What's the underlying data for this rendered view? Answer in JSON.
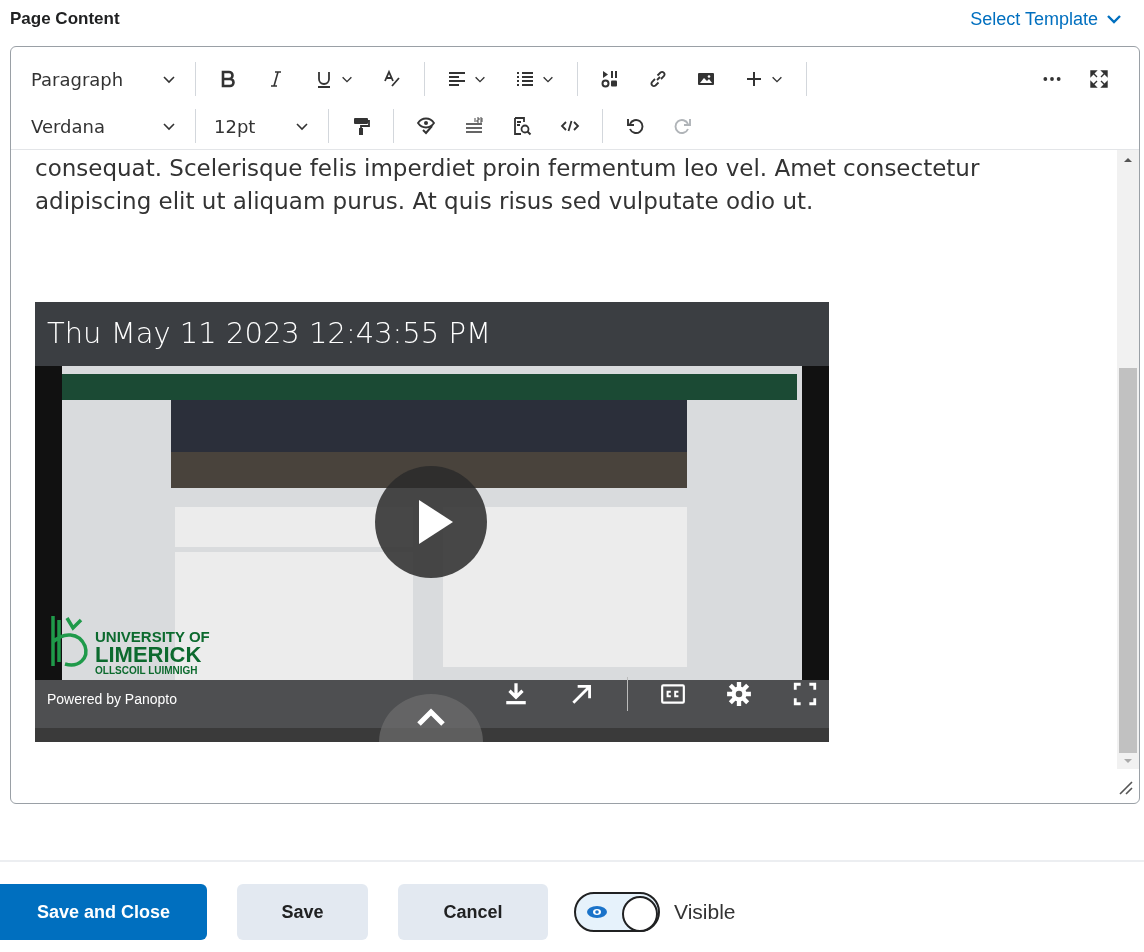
{
  "header": {
    "title": "Page Content",
    "template_link": "Select Template"
  },
  "toolbar": {
    "rows": [
      [
        [
          {
            "kind": "select",
            "label": "Paragraph"
          }
        ],
        [
          {
            "kind": "tool"
          },
          {
            "kind": "tool"
          },
          {
            "kind": "tool",
            "menu": true
          },
          {
            "kind": "tool"
          }
        ],
        [
          {
            "kind": "tool",
            "menu": true
          },
          {
            "kind": "tool",
            "menu": true
          }
        ],
        [
          {
            "kind": "tool"
          },
          {
            "kind": "tool"
          },
          {
            "kind": "tool"
          },
          {
            "kind": "tool",
            "menu": true
          }
        ],
        [
          {
            "kind": "tool"
          },
          {
            "kind": "tool"
          }
        ]
      ],
      [
        [
          {
            "kind": "select",
            "label": "Verdana"
          }
        ],
        [
          {
            "kind": "select",
            "label": "12pt"
          }
        ],
        [
          {
            "kind": "tool"
          }
        ],
        [
          {
            "kind": "tool"
          },
          {
            "kind": "tool"
          },
          {
            "kind": "tool"
          },
          {
            "kind": "tool"
          }
        ],
        [
          {
            "kind": "tool"
          },
          {
            "kind": "tool",
            "disabled": true
          }
        ]
      ]
    ]
  },
  "content": {
    "paragraph": "consequat. Scelerisque felis imperdiet proin fermentum leo vel. Amet consectetur adipiscing elit ut aliquam purus. At quis risus sed vulputate odio ut.",
    "video": {
      "kind": "picture",
      "title": "Thu May 11 2023 12:43:55 PM",
      "logo": [
        "UNIVERSITY OF",
        "LIMERICK",
        "OLLSCOIL LUIMNIGH"
      ],
      "credit": "Powered by Panopto"
    }
  },
  "footer": {
    "buttons": [
      {
        "label": "Save and Close",
        "primary": true
      },
      {
        "label": "Save",
        "primary": false
      },
      {
        "label": "Cancel",
        "primary": false
      }
    ],
    "visibility": {
      "on": true,
      "label": "Visible"
    }
  }
}
